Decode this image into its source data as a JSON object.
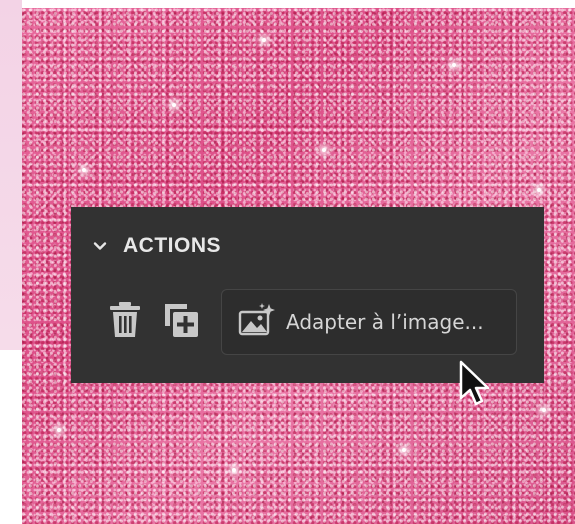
{
  "panel": {
    "title": "ACTIONS",
    "collapse_icon": "chevron-down-icon",
    "delete_icon": "trash-icon",
    "duplicate_icon": "duplicate-layer-icon",
    "fit_button": {
      "label": "Adapter à l’image...",
      "icon": "sparkle-image-icon"
    }
  },
  "colors": {
    "panel_bg": "#323232",
    "button_border": "#454545",
    "text": "#e6e6e6",
    "canvas_pink": "#e25d93"
  }
}
